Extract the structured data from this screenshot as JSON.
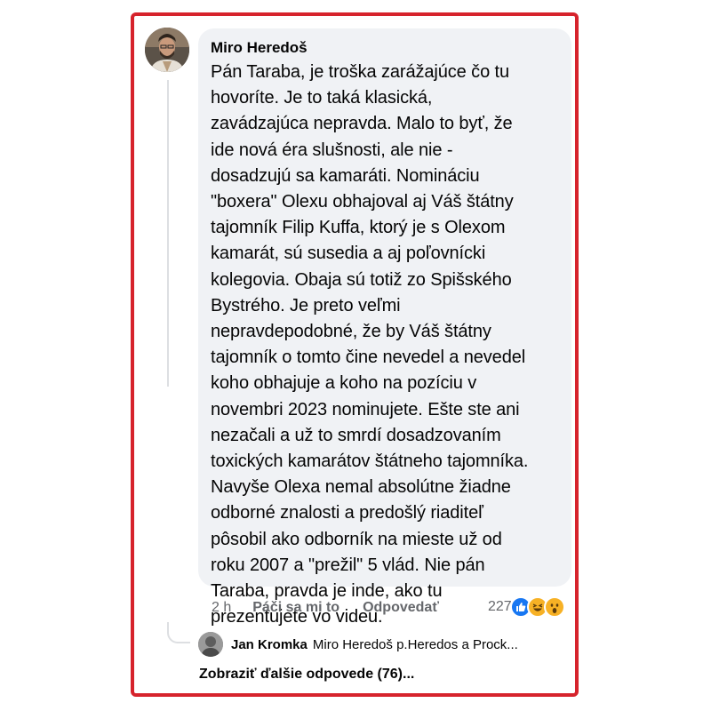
{
  "comment": {
    "author": "Miro Heredoš",
    "text": "Pán Taraba, je troška zarážajúce čo tu\nhovoríte. Je to taká klasická,\nzavádzajúca nepravda. Malo to byť, že\nide nová éra slušnosti, ale nie -\ndosadzujú sa kamaráti. Nomináciu\n\"boxera\" Olexu obhajoval aj Váš štátny\ntajomník Filip Kuffa, ktorý je s Olexom\nkamarát, sú susedia a aj poľovnícki\nkolegovia. Obaja sú totiž zo Spišského\nBystrého. Je preto veľmi\nnepravdepodobné, že by Váš štátny\ntajomník o tomto čine nevedel a nevedel\nkoho obhajuje a koho na pozíciu v\nnovembri 2023 nominujete. Ešte ste ani\nnezačali a už to smrdí dosadzovaním\ntoxických kamarátov štátneho tajomníka.\nNavyše Olexa nemal absolútne žiadne\nodborné znalosti a predošlý riaditeľ\npôsobil ako odborník na mieste už od\nroku 2007 a \"prežil\" 5 vlád. Nie pán\nTaraba, pravda je inde, ako tu\nprezentujete vo videu.",
    "time": "2 h",
    "like_label": "Páči sa mi to",
    "reply_label": "Odpovedať",
    "reaction_count": "227",
    "reactions": [
      "like-icon",
      "haha-icon",
      "wow-icon"
    ]
  },
  "reply": {
    "author": "Jan Kromka",
    "text": "Miro Heredoš p.Heredos a Prock..."
  },
  "more_replies_label": "Zobraziť ďalšie odpovede (76)...",
  "colors": {
    "frame": "#d6232c",
    "bubble": "#f0f2f5",
    "secondary_text": "#65676b",
    "like": "#1877f2",
    "emoji": "#f7b125"
  }
}
